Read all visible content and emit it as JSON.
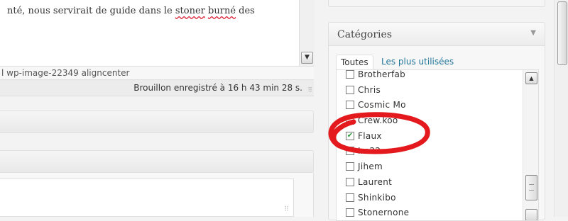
{
  "editor": {
    "text_before": "nté, nous servirait de guide dans le ",
    "text_misspelled_1": "stoner",
    "text_space": " ",
    "text_misspelled_2": "burné",
    "text_after": " des",
    "path": "l wp-image-22349 aligncenter",
    "status": "Brouillon enregistré à 16 h 43 min 28 s."
  },
  "categories": {
    "title": "Catégories",
    "tabs": [
      {
        "label": "Toutes",
        "active": true
      },
      {
        "label": "Les plus utilisées",
        "active": false
      }
    ],
    "items": [
      {
        "label": "Brotherfab",
        "checked": false
      },
      {
        "label": "Chris",
        "checked": false
      },
      {
        "label": "Cosmic Mo",
        "checked": false
      },
      {
        "label": "Crew.koo",
        "checked": false
      },
      {
        "label": "Flaux",
        "checked": true
      },
      {
        "label": "Ire22",
        "checked": false
      },
      {
        "label": "Jihem",
        "checked": false
      },
      {
        "label": "Laurent",
        "checked": false
      },
      {
        "label": "Shinkibo",
        "checked": false
      },
      {
        "label": "Stonernone",
        "checked": false
      }
    ]
  },
  "icons": {
    "checkmark": "✔",
    "toggle": "▼",
    "scroll_up": "▲",
    "scroll_down": "▼"
  },
  "colors": {
    "link": "#21759b",
    "highlight": "#e3191d",
    "checkmark": "#2a9c3a"
  }
}
